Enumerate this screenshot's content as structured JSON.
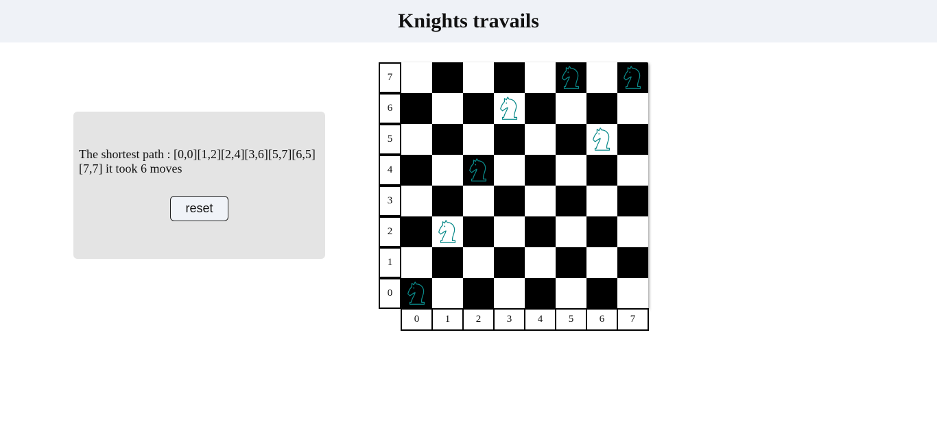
{
  "header": {
    "title": "Knights travails"
  },
  "panel": {
    "result_text": "The shortest path : [0,0][1,2][2,4][3,6][5,7][6,5][7,7] it took 6 moves",
    "reset_label": "reset"
  },
  "board": {
    "size": 8,
    "rank_labels": [
      "7",
      "6",
      "5",
      "4",
      "3",
      "2",
      "1",
      "0"
    ],
    "file_labels": [
      "0",
      "1",
      "2",
      "3",
      "4",
      "5",
      "6",
      "7"
    ],
    "knight_icon": "knight-icon",
    "knight_color": "#0a8a8a",
    "light_color": "#ffffff",
    "dark_color": "#000000",
    "knights": [
      [
        0,
        0
      ],
      [
        1,
        2
      ],
      [
        2,
        4
      ],
      [
        3,
        6
      ],
      [
        5,
        7
      ],
      [
        6,
        5
      ],
      [
        7,
        7
      ]
    ]
  }
}
